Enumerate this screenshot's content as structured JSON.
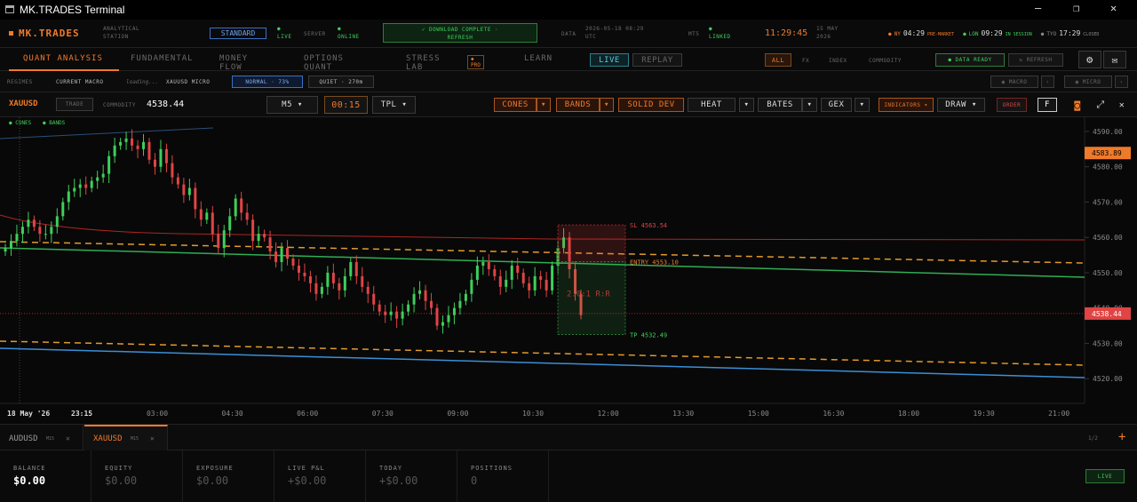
{
  "window": {
    "title": "MK.TRADES Terminal",
    "min": "—",
    "max": "❐",
    "close": "✕"
  },
  "brand": {
    "name": "MK.TRADES",
    "sub1": "ANALYTICAL",
    "sub2": "STATION"
  },
  "status": {
    "plan": "STANDARD",
    "live_dot": "●",
    "live": "LIVE",
    "server_label": "SERVER",
    "online_dot": "●",
    "online": "ONLINE",
    "download_line1": "✓ DOWNLOAD COMPLETE ·",
    "download_line2": "REFRESH",
    "data_label": "DATA",
    "date": "2026-05-18 08:29",
    "tz": "UTC",
    "mt5_label": "MT5",
    "linked_dot": "●",
    "linked": "LINKED",
    "clock": "11:29:45",
    "day": "15 MAY",
    "year": "2026"
  },
  "sessions": [
    {
      "dot": "●",
      "name": "NY",
      "time": "04:29",
      "tag": "PRE-MARKET",
      "color": "#f07a2a"
    },
    {
      "dot": "●",
      "name": "LON",
      "time": "09:29",
      "tag": "IN SESSION",
      "color": "#3ecf5a"
    },
    {
      "dot": "●",
      "name": "TYO",
      "time": "17:29",
      "tag": "CLOSED",
      "color": "#888888"
    }
  ],
  "nav": {
    "tabs": [
      "QUANT ANALYSIS",
      "FUNDAMENTAL",
      "MONEY FLOW",
      "OPTIONS QUANT",
      "STRESS LAB",
      "LEARN"
    ],
    "pro": "◆ PRO",
    "live": "LIVE",
    "replay": "REPLAY",
    "filters": [
      "ALL",
      "FX",
      "INDEX",
      "COMMODITY"
    ],
    "data_ready": "● DATA READY",
    "refresh": "↻ REFRESH"
  },
  "regimes": {
    "label": "REGIMES",
    "macro": "CURRENT MACRO",
    "loading": "loading...",
    "micro": "XAUUSD MICRO",
    "normal": "NORMAL · 73%",
    "quiet": "QUIET · 270m",
    "macro_btn": "◉ MACRO",
    "micro_btn": "◉ MICRO"
  },
  "toolbar": {
    "symbol": "XAUUSD",
    "trade": "TRADE",
    "type": "COMMODITY",
    "price": "4538.44",
    "tf": "M5 ▾",
    "countdown": "00:15",
    "tpl": "TPL ▾",
    "cones": "CONES",
    "bands": "BANDS",
    "solid": "SOLID DEV",
    "heat": "HEAT",
    "bates": "BATES",
    "gex": "GEX",
    "indicators": "INDICATORS ▾",
    "draw": "DRAW ▾",
    "order": "ORDER",
    "f": "F",
    "caret": "▾"
  },
  "legend": {
    "cones": "● CONES",
    "bands": "● BANDS"
  },
  "chart_data": {
    "type": "candlestick",
    "symbol": "XAUUSD",
    "timeframe": "M5",
    "date": "18 May '26",
    "cursor_time": "23:15",
    "x_ticks": [
      "03:00",
      "04:30",
      "06:00",
      "07:30",
      "09:00",
      "10:30",
      "12:00",
      "13:30",
      "15:00",
      "16:30",
      "18:00",
      "19:30",
      "21:00"
    ],
    "y_ticks": [
      "4590.00",
      "4580.00",
      "4570.00",
      "4560.00",
      "4550.00",
      "4540.00",
      "4530.00",
      "4520.00"
    ],
    "ylim": [
      4513,
      4592
    ],
    "current_price": "4538.44",
    "upper_label": "4583.89",
    "sl": "SL 4563.54",
    "entry": "ENTRY 4553.10",
    "tp": "TP 4532.49",
    "rr": "2.0:1 R:R",
    "closes": [
      4557,
      4559,
      4561,
      4563,
      4565,
      4563,
      4561,
      4561,
      4563,
      4566,
      4570,
      4573,
      4574,
      4575,
      4574,
      4576,
      4577,
      4578,
      4583,
      4586,
      4587,
      4588,
      4586,
      4585,
      4587,
      4582,
      4580,
      4585,
      4581,
      4577,
      4575,
      4572,
      4574,
      4568,
      4565,
      4567,
      4561,
      4557,
      4562,
      4566,
      4571,
      4567,
      4565,
      4559,
      4561,
      4560,
      4556,
      4553,
      4557,
      4554,
      4552,
      4550,
      4549,
      4547,
      4544,
      4546,
      4550,
      4547,
      4545,
      4549,
      4553,
      4549,
      4546,
      4544,
      4541,
      4539,
      4538,
      4539,
      4537,
      4539,
      4541,
      4544,
      4545,
      4542,
      4540,
      4535,
      4536,
      4538,
      4540,
      4542,
      4544,
      4548,
      4552,
      4553,
      4551,
      4549,
      4546,
      4548,
      4552,
      4550,
      4547,
      4545,
      4549,
      4548,
      4545,
      4552,
      4557,
      4560,
      4551,
      4544,
      4538
    ]
  },
  "tabs": [
    {
      "name": "AUDUSD",
      "tag": "M15",
      "close": "✕"
    },
    {
      "name": "XAUUSD",
      "tag": "M15",
      "close": "✕"
    }
  ],
  "pager": "1/2",
  "plus": "+",
  "account": [
    {
      "label": "BALANCE",
      "value": "$0.00"
    },
    {
      "label": "EQUITY",
      "value": "$0.00"
    },
    {
      "label": "EXPOSURE",
      "value": "$0.00"
    },
    {
      "label": "LIVE P&L",
      "value": "+$0.00"
    },
    {
      "label": "TODAY",
      "value": "+$0.00"
    },
    {
      "label": "POSITIONS",
      "value": "0"
    }
  ],
  "account_status": "LIVE",
  "colors": {
    "accent": "#f07a2a",
    "green": "#3ecf5a",
    "red": "#e04444",
    "blue": "#3b8fd6",
    "band": "#e39a2c"
  }
}
